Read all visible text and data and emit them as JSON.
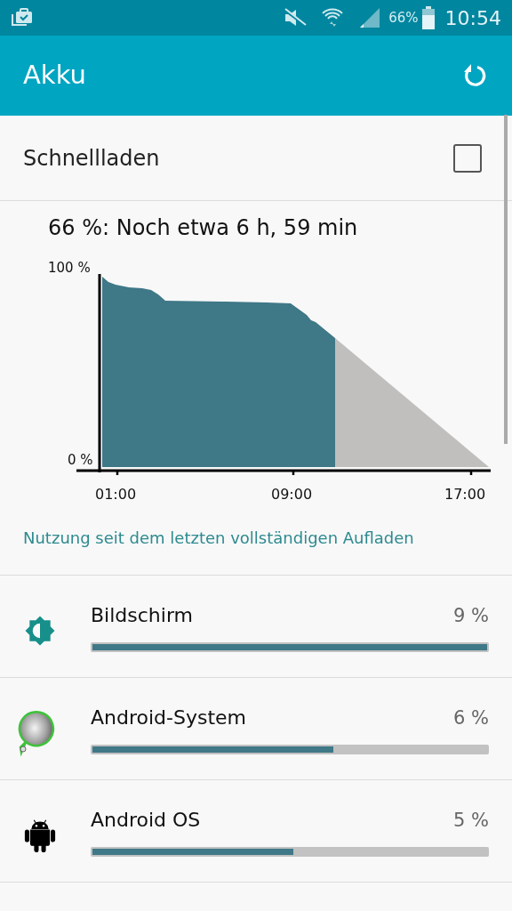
{
  "status_bar": {
    "battery_percent": "66%",
    "time": "10:54"
  },
  "app_bar": {
    "title": "Akku"
  },
  "fast_charge": {
    "label": "Schnellladen",
    "checked": false
  },
  "estimate": "66 %: Noch etwa 6 h, 59 min",
  "battery_graph": {
    "y_labels": [
      "100 %",
      "0 %"
    ],
    "x_labels": [
      "01:00",
      "09:00",
      "17:00"
    ]
  },
  "usage_link": "Nutzung seit dem letzten vollständigen Aufladen",
  "apps": [
    {
      "kind": "brightness",
      "name": "Bildschirm",
      "percent": "9 %",
      "level": 1.0
    },
    {
      "kind": "system",
      "name": "Android-System",
      "percent": "6 %",
      "level": 0.61
    },
    {
      "kind": "android",
      "name": "Android OS",
      "percent": "5 %",
      "level": 0.51
    }
  ]
}
